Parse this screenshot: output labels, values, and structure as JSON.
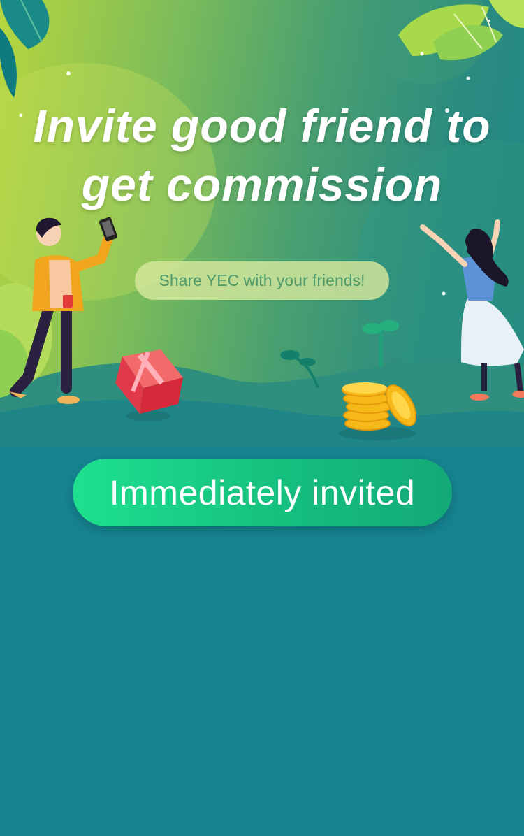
{
  "hero": {
    "title_line1": "Invite good friend to",
    "title_line2": "get commission",
    "subtitle": "Share YEC with your friends!"
  },
  "actions": {
    "invite_label": "Immediately invited"
  },
  "colors": {
    "page_background": "#168390",
    "button_start": "#1ee08f",
    "button_end": "#13a978",
    "pill_background": "#d6e89c",
    "pill_text": "#4f9a6a"
  },
  "illustrations": [
    "man-with-phone-illustration",
    "woman-cheering-illustration",
    "gift-box-icon",
    "gold-coins-icon",
    "leaf-plant-icon"
  ]
}
